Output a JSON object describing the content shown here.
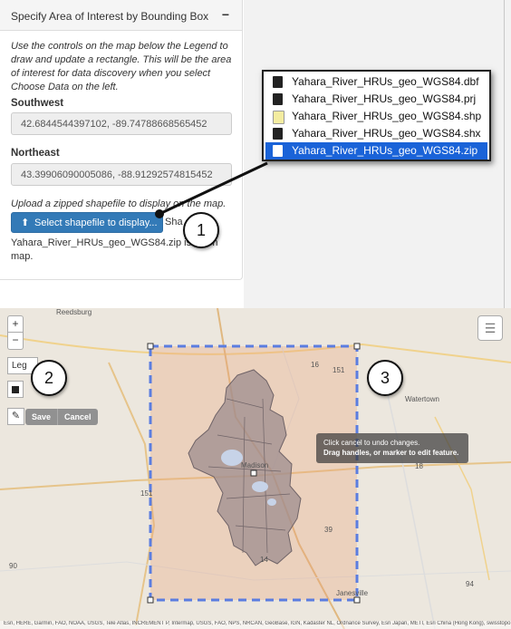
{
  "panel": {
    "title": "Specify Area of Interest by Bounding Box",
    "collapse_symbol": "−",
    "instructions": "Use the controls on the map below the Legend to draw and update a rectangle. This will be the area of interest for data discovery when you select Choose Data on the left.",
    "southwest_label": "Southwest",
    "southwest_value": "42.6844544397102, -89.74788668565452",
    "northeast_label": "Northeast",
    "northeast_value": "43.39906090005086, -88.91292574815452",
    "upload_instructions": "Upload a zipped shapefile to display on the map.",
    "upload_button_label": "Select shapefile to display...",
    "upload_icon": "upload-icon",
    "shape_label": "Sha",
    "status_text": "Yahara_River_HRUs_geo_WGS84.zip is   ile on map."
  },
  "finder": {
    "files": [
      {
        "name": "Yahara_River_HRUs_geo_WGS84.dbf",
        "selected": false
      },
      {
        "name": "Yahara_River_HRUs_geo_WGS84.prj",
        "selected": false
      },
      {
        "name": "Yahara_River_HRUs_geo_WGS84.shp",
        "selected": false
      },
      {
        "name": "Yahara_River_HRUs_geo_WGS84.shx",
        "selected": false
      },
      {
        "name": "Yahara_River_HRUs_geo_WGS84.zip",
        "selected": true
      }
    ],
    "selected_color": "#1a63d8"
  },
  "callouts": [
    "1",
    "2",
    "3"
  ],
  "map": {
    "zoom_in": "+",
    "zoom_out": "−",
    "legend_label": "Leg",
    "edit_icon": "edit-icon",
    "rectangle_icon": "rectangle-icon",
    "layers_icon": "layers-icon",
    "save_label": "Save",
    "cancel_label": "Cancel",
    "tooltip_line1": "Click cancel to undo changes.",
    "tooltip_line2": "Drag handles, or marker to edit feature.",
    "places": {
      "reedsburg": "Reedsburg",
      "watertown": "Watertown",
      "madison": "Madison",
      "janesville": "Janesville"
    },
    "route_labels": [
      "16",
      "151",
      "18",
      "151",
      "14",
      "39",
      "94",
      "90",
      "26",
      "43",
      "11",
      "151"
    ],
    "attribution": "Esri, HERE, Garmin, FAO, NOAA, USGS, Tele Atlas, INCREMENT P, Intermap, USGS, FAO, NPS, NRCAN, GeoBase, IGN, Kadaster NL, Ordnance Survey, Esri Japan, METI, Esri China (Hong Kong), swisstopo",
    "colors": {
      "bbox_stroke": "#5b7de0",
      "bbox_fill": "#e8a27a",
      "watershed": "#9e8c8f",
      "lakes": "#c7d3e8"
    }
  }
}
